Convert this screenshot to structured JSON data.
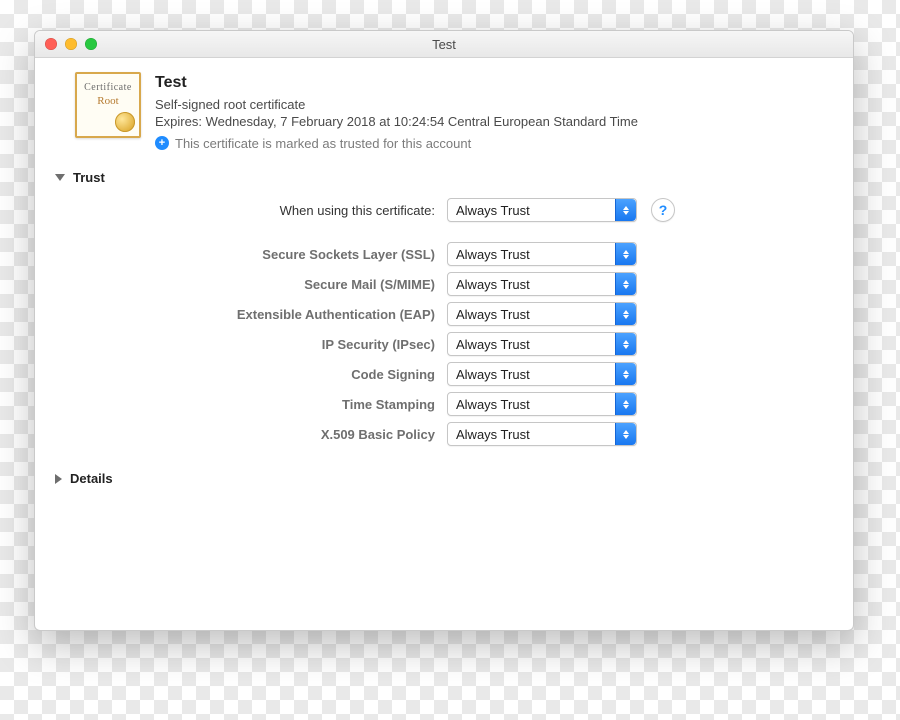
{
  "window": {
    "title": "Test"
  },
  "certificate": {
    "name": "Test",
    "kind": "Self-signed root certificate",
    "expires": "Expires: Wednesday, 7 February 2018 at 10:24:54 Central European Standard Time",
    "trust_status": "This certificate is marked as trusted for this account",
    "icon_word": "Certificate",
    "icon_script": "Root"
  },
  "sections": {
    "trust_label": "Trust",
    "details_label": "Details"
  },
  "trust": {
    "main_label": "When using this certificate:",
    "main_value": "Always Trust",
    "help_glyph": "?",
    "rows": [
      {
        "label": "Secure Sockets Layer (SSL)",
        "value": "Always Trust"
      },
      {
        "label": "Secure Mail (S/MIME)",
        "value": "Always Trust"
      },
      {
        "label": "Extensible Authentication (EAP)",
        "value": "Always Trust"
      },
      {
        "label": "IP Security (IPsec)",
        "value": "Always Trust"
      },
      {
        "label": "Code Signing",
        "value": "Always Trust"
      },
      {
        "label": "Time Stamping",
        "value": "Always Trust"
      },
      {
        "label": "X.509 Basic Policy",
        "value": "Always Trust"
      }
    ]
  }
}
